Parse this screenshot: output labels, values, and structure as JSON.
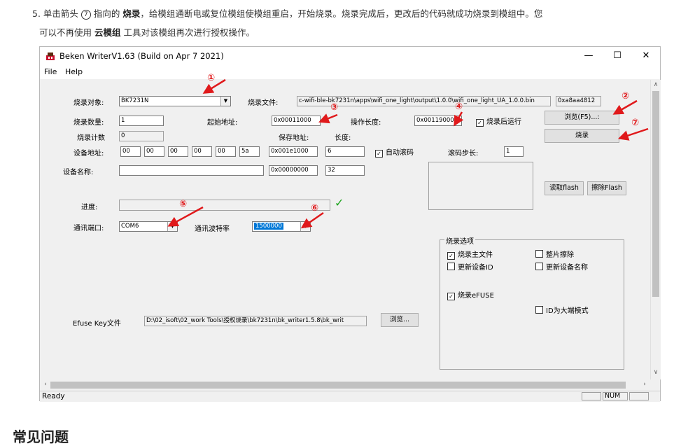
{
  "instruction": {
    "num": "5.",
    "p1": "单击箭头",
    "circ": "7",
    "p2": "指向的",
    "b1": "烧录",
    "p3": "，给模组通断电或复位模组使模组重启，开始烧录。烧录完成后，更改后的代码就成功烧录到模组中。您",
    "p4": "可以不再使用",
    "b2": "云模组",
    "p5": "工具对该模组再次进行授权操作。"
  },
  "window": {
    "title": "Beken WriterV1.63 (Build on Apr  7 2021)",
    "minimize": "—",
    "maximize": "☐",
    "close": "✕",
    "menu": [
      "File",
      "Help"
    ]
  },
  "form": {
    "target_label": "烧录对象:",
    "target_value": "BK7231N",
    "file_label": "烧录文件:",
    "file_value": "c-wifi-ble-bk7231n\\apps\\wifi_one_light\\output\\1.0.0\\wifi_one_light_UA_1.0.0.bin",
    "checksum": "0xa8aa4812",
    "browse_f5": "浏览(F5)...:",
    "burn": "烧录",
    "count_label": "烧录数量:",
    "count_value": "1",
    "start_addr_label": "起始地址:",
    "start_addr_value": "0x00011000",
    "op_len_label": "操作长度:",
    "op_len_value": "0x00119000",
    "run_after": "烧录后运行",
    "counter_label": "烧录计数",
    "counter_value": "0",
    "save_addr_label": "保存地址:",
    "length_label": "长度:",
    "device_addr_label": "设备地址:",
    "device_addr": [
      "00",
      "00",
      "00",
      "00",
      "00",
      "5a"
    ],
    "save_addr_1": "0x001e1000",
    "length_1": "6",
    "auto_roll": "自动滚码",
    "roll_step_label": "滚码步长:",
    "roll_step_value": "1",
    "device_name_label": "设备名称:",
    "device_name_value": "",
    "save_addr_2": "0x00000000",
    "length_2": "32",
    "read_flash": "读取flash",
    "erase_flash": "擦除Flash",
    "progress_label": "进度:",
    "progress": 0,
    "port_label": "通讯端口:",
    "port_value": "COM6",
    "baud_label": "通讯波特率",
    "baud_value": "1500000",
    "efuse_label": "Efuse Key文件",
    "efuse_path": "D:\\02_isoft\\02_work Tools\\授权烧录\\bk7231n\\bk_writer1.5.8\\bk_writ",
    "efuse_browse": "浏览..."
  },
  "options": {
    "title": "烧录选项",
    "main_file": "烧录主文件",
    "chip_erase": "整片擦除",
    "update_id": "更新设备ID",
    "update_name": "更新设备名称",
    "efuse": "烧录eFUSE",
    "big_endian": "ID为大端模式",
    "checked_mark": "☑",
    "check_on": "✓"
  },
  "status": {
    "text": "Ready",
    "num": "NUM"
  },
  "markers": [
    "①",
    "②",
    "③",
    "④",
    "⑤",
    "⑥",
    "⑦"
  ],
  "tick": "✓",
  "heading": "常见问题",
  "colors": {
    "annotation": "#e0191b",
    "selection": "#0078d7",
    "tick": "#1aa31a"
  }
}
